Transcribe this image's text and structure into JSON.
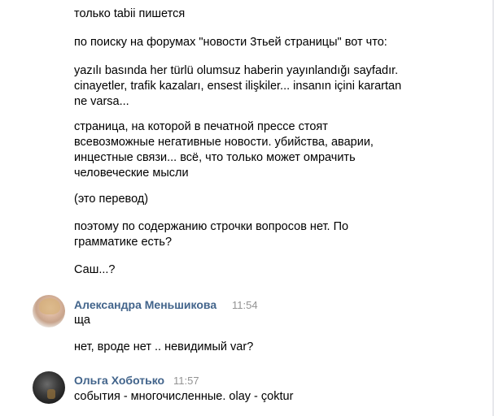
{
  "messages_top": [
    "только tabii пишется",
    "по поиску на форумах \"новости 3тьей страницы\" вот что:",
    "yazılı basında her türlü olumsuz haberin yayınlandığı sayfadır.\ncinayetler, trafik kazaları, ensest ilişkiler... insanın içini karartan\nne varsa...",
    "страница, на которой в печатной прессе стоят\nвсевозможные негативные новости. убийства, аварии,\nинцестные связи... всё, что только может омрачить\nчеловеческие мысли",
    "(это перевод)",
    "поэтому по содержанию строчки вопросов нет. По\nграмматике есть?",
    "Саш...?"
  ],
  "posts": [
    {
      "author": "Александра Меньшикова",
      "time": "11:54",
      "avatar": "user-photo-woman",
      "messages": [
        "ща",
        "нет, вроде нет .. невидимый var?"
      ]
    },
    {
      "author": "Ольга Хоботько",
      "time": "11:57",
      "avatar": "user-photo-dark",
      "messages": [
        "события - многочисленные. olay - çoktur"
      ]
    }
  ],
  "colors": {
    "author_link": "#42648b",
    "timestamp": "#939393",
    "text": "#000000",
    "background": "#ffffff"
  }
}
